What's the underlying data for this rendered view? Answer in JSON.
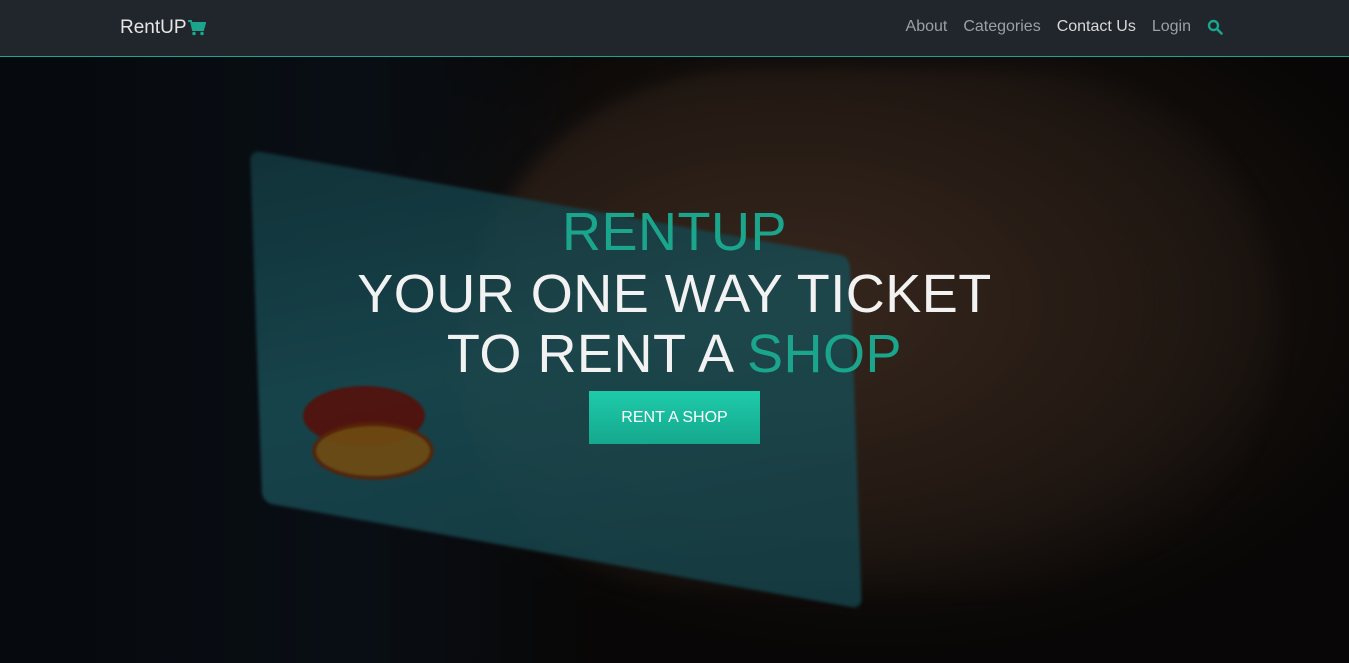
{
  "navbar": {
    "brand": "RentUP",
    "brand_icon": "shopping-cart-icon",
    "links": [
      "About",
      "Categories",
      "Contact Us",
      "Login"
    ],
    "search_icon": "search-icon",
    "accent_color": "#1aa58c"
  },
  "hero": {
    "line1": "RENTUP",
    "line2": "YOUR ONE WAY TICKET",
    "line3_prefix": "TO RENT A ",
    "line3_accent": "SHOP",
    "cta_label": "RENT A SHOP"
  }
}
